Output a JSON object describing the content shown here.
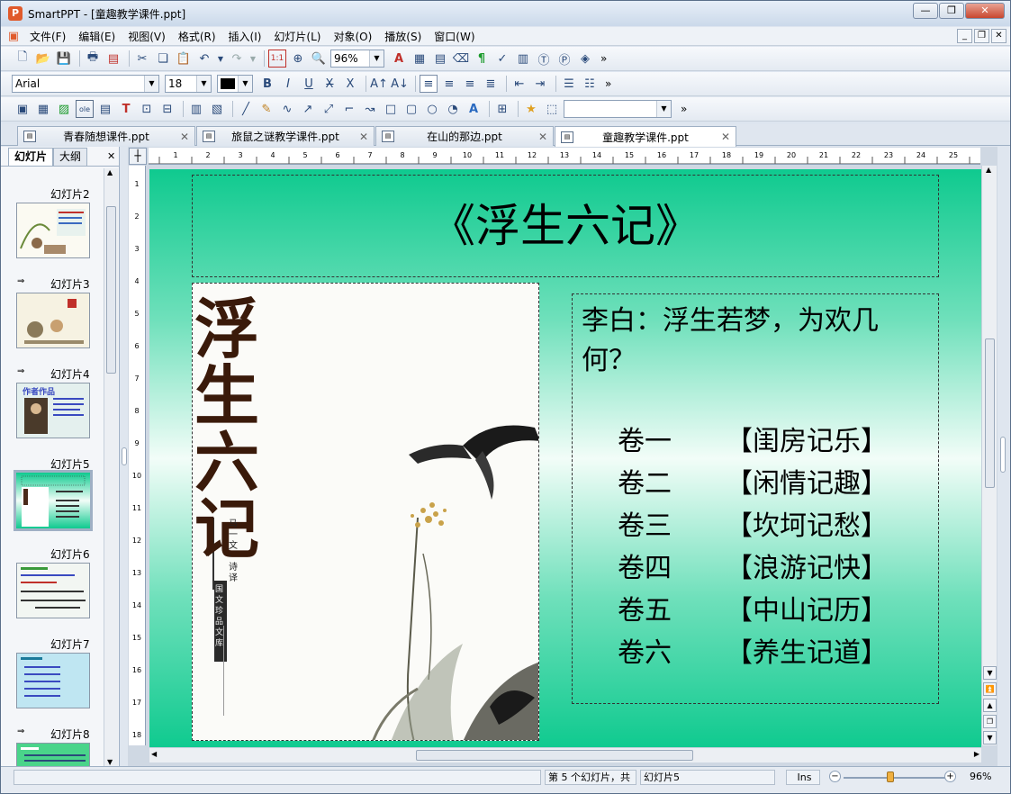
{
  "window": {
    "title": "SmartPPT - [童趣教学课件.ppt]",
    "app_icon": "P"
  },
  "menu": [
    "文件(F)",
    "编辑(E)",
    "视图(V)",
    "格式(R)",
    "插入(I)",
    "幻灯片(L)",
    "对象(O)",
    "播放(S)",
    "窗口(W)"
  ],
  "toolbar1": {
    "zoom": "96%",
    "more": "»"
  },
  "toolbar2": {
    "font": "Arial",
    "size": "18",
    "bold": "B",
    "italic": "I",
    "underline": "U",
    "more": "»"
  },
  "toolbar3": {
    "more": "»"
  },
  "doc_tabs": [
    {
      "label": "青春随想课件.ppt"
    },
    {
      "label": "旅鼠之谜教学课件.ppt"
    },
    {
      "label": "在山的那边.ppt"
    },
    {
      "label": "童趣教学课件.ppt"
    }
  ],
  "left_pane": {
    "tabs": [
      "幻灯片",
      "大纲"
    ],
    "slides": [
      {
        "label": "幻灯片2"
      },
      {
        "label": "幻灯片3"
      },
      {
        "label": "幻灯片4",
        "thumb_text": "作者作品"
      },
      {
        "label": "幻灯片5"
      },
      {
        "label": "幻灯片6"
      },
      {
        "label": "幻灯片7"
      },
      {
        "label": "幻灯片8"
      }
    ]
  },
  "slide": {
    "title": "《浮生六记》",
    "intro": "李白：浮生若梦，为欢几何？",
    "chapters": [
      {
        "vol": "卷一",
        "name": "【闺房记乐】"
      },
      {
        "vol": "卷二",
        "name": "【闲情记趣】"
      },
      {
        "vol": "卷三",
        "name": "【坎坷记愁】"
      },
      {
        "vol": "卷四",
        "name": "【浪游记快】"
      },
      {
        "vol": "卷五",
        "name": "【中山记历】"
      },
      {
        "vol": "卷六",
        "name": "【养生记道】"
      }
    ],
    "cover": {
      "big_title": [
        "浮",
        "生",
        "六",
        "记"
      ],
      "author": "马一文·诗译",
      "series": "国文珍品文库"
    }
  },
  "status": {
    "count": "第 5 个幻灯片，共",
    "current": "幻灯片5",
    "mode": "Ins",
    "zoom": "96%"
  }
}
